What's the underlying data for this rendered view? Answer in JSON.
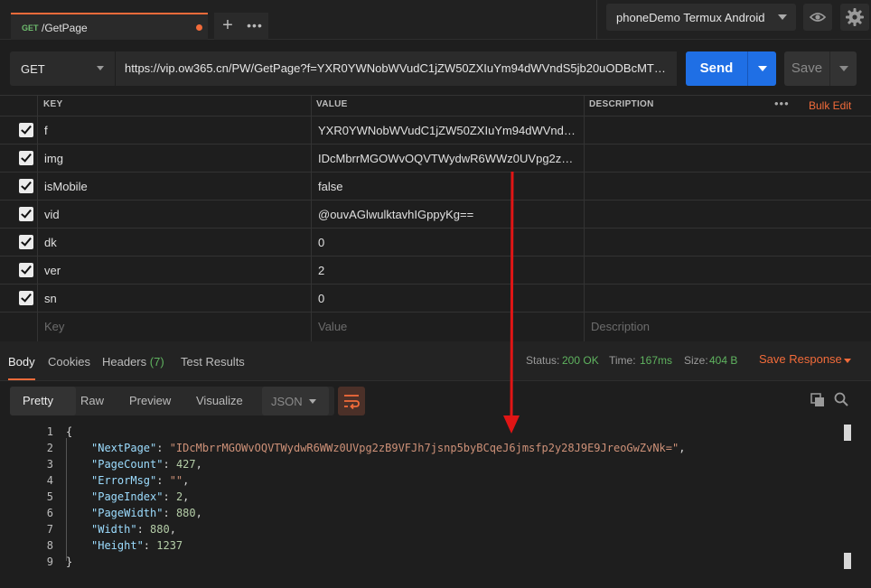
{
  "tab": {
    "method": "GET",
    "name": "/GetPage"
  },
  "env": {
    "label": "phoneDemo Termux Android"
  },
  "request": {
    "method": "GET",
    "url": "https://vip.ow365.cn/PW/GetPage?f=YXR0YWNobWVudC1jZW50ZXIuYm94dWVndS5jb20uODBcMThmNWJi...",
    "send_label": "Send",
    "save_label": "Save"
  },
  "params": {
    "headers": {
      "key": "KEY",
      "value": "VALUE",
      "description": "DESCRIPTION",
      "bulk_edit": "Bulk Edit"
    },
    "rows": [
      {
        "key": "f",
        "value": "YXR0YWNobWVudC1jZW50ZXIuYm94dWVndS5jb...",
        "checked": true
      },
      {
        "key": "img",
        "value": "IDcMbrrMGOWvOQVTWydwR6WWz0UVpg2zB9VF...",
        "checked": true
      },
      {
        "key": "isMobile",
        "value": "false",
        "checked": true
      },
      {
        "key": "vid",
        "value": "@ouvAGlwulktavhIGppyKg==",
        "checked": true
      },
      {
        "key": "dk",
        "value": "0",
        "checked": true
      },
      {
        "key": "ver",
        "value": "2",
        "checked": true
      },
      {
        "key": "sn",
        "value": "0",
        "checked": true
      }
    ],
    "placeholder": {
      "key": "Key",
      "value": "Value",
      "description": "Description"
    }
  },
  "response": {
    "tabs": {
      "body": "Body",
      "cookies": "Cookies",
      "headers": "Headers",
      "headers_count": "(7)",
      "tests": "Test Results"
    },
    "status_label": "Status:",
    "status": "200 OK",
    "time_label": "Time:",
    "time": "167ms",
    "size_label": "Size:",
    "size": "404 B",
    "save_response": "Save Response",
    "views": {
      "pretty": "Pretty",
      "raw": "Raw",
      "preview": "Preview",
      "visualize": "Visualize"
    },
    "format": "JSON",
    "lines": [
      "1",
      "2",
      "3",
      "4",
      "5",
      "6",
      "7",
      "8",
      "9"
    ],
    "json": {
      "next_page_key": "\"NextPage\"",
      "next_page_val": "\"IDcMbrrMGOWvOQVTWydwR6WWz0UVpg2zB9VFJh7jsnp5byBCqeJ6jmsfp2y28J9E9JreoGwZvNk=\"",
      "page_count_key": "\"PageCount\"",
      "page_count_val": "427",
      "error_key": "\"ErrorMsg\"",
      "error_val": "\"\"",
      "page_index_key": "\"PageIndex\"",
      "page_index_val": "2",
      "page_width_key": "\"PageWidth\"",
      "page_width_val": "880",
      "width_key": "\"Width\"",
      "width_val": "880",
      "height_key": "\"Height\"",
      "height_val": "1237"
    }
  },
  "colors": {
    "accent": "#f26b3a",
    "primary": "#1f6fe5",
    "success": "#5fb35f",
    "annotation": "#e01515"
  }
}
